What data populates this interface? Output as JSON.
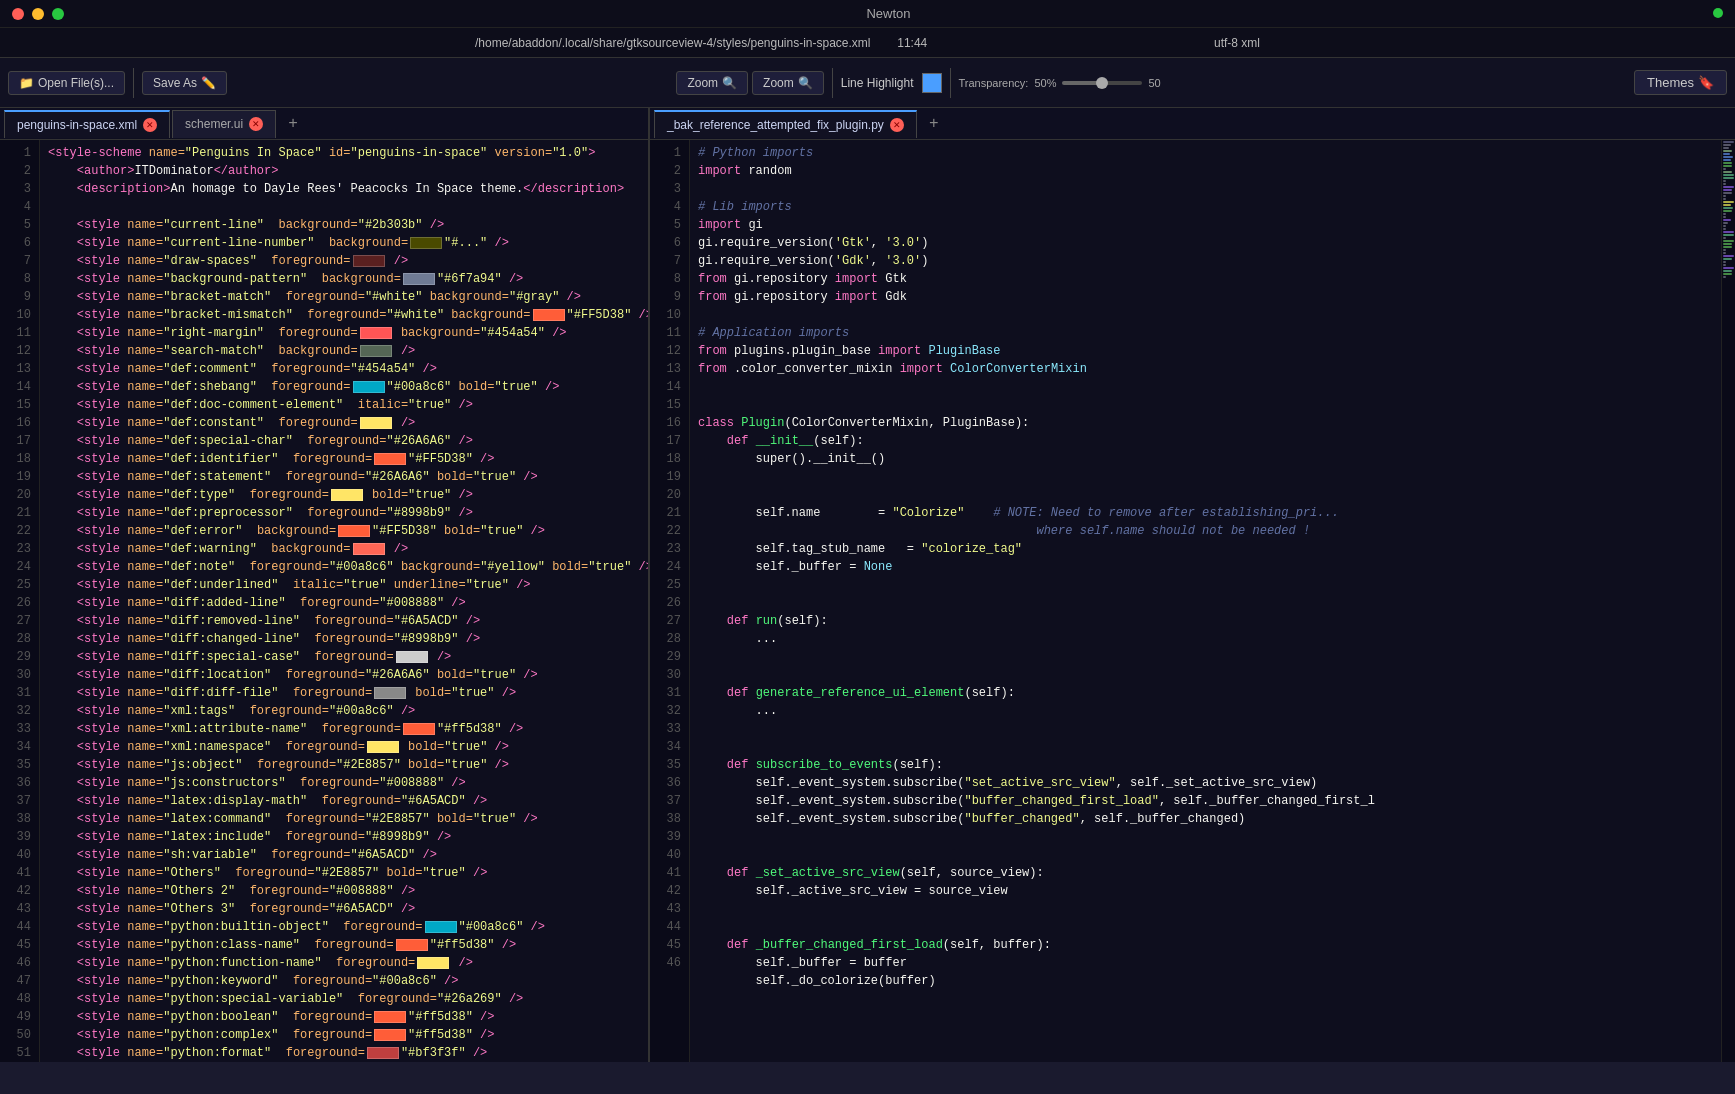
{
  "titlebar": {
    "title": "Newton",
    "path": "/home/abaddon/.local/share/gtksourceview-4/styles/penguins-in-space.xml",
    "time": "11:44",
    "encoding": "utf-8",
    "filetype": "xml"
  },
  "toolbar": {
    "open_label": "Open File(s)...",
    "save_as_label": "Save As",
    "zoom_in_label": "Zoom",
    "zoom_out_label": "Zoom",
    "line_highlight_label": "Line Highlight",
    "transparency_label": "Transparency:",
    "transparency_value": "50%",
    "transparency_num": "50",
    "themes_label": "Themes"
  },
  "tabs_left": [
    {
      "label": "penguins-in-space.xml",
      "active": true
    },
    {
      "label": "schemer.ui",
      "active": false
    }
  ],
  "tabs_right": [
    {
      "label": "_bak_reference_attempted_fix_plugin.py",
      "active": true
    }
  ],
  "left_lines": 51,
  "right_lines": 46
}
